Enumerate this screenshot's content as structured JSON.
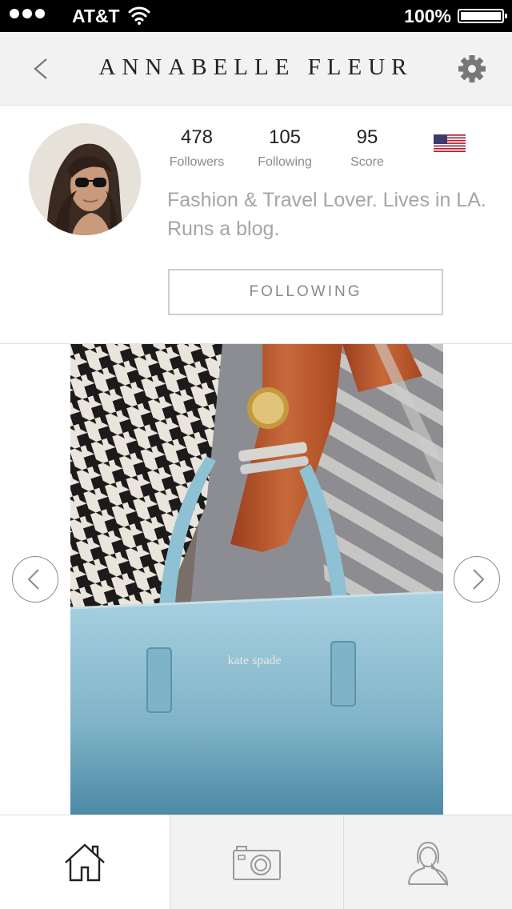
{
  "status_bar": {
    "carrier": "AT&T",
    "battery": "100%",
    "signal_icon": "signal-dots-icon",
    "wifi_icon": "wifi-icon",
    "battery_icon": "battery-icon"
  },
  "header": {
    "title": "ANNABELLE FLEUR",
    "back_icon": "chevron-left-icon",
    "settings_icon": "gear-icon"
  },
  "profile": {
    "stats": {
      "followers": {
        "value": "478",
        "label": "Followers"
      },
      "following": {
        "value": "105",
        "label": "Following"
      },
      "score": {
        "value": "95",
        "label": "Score"
      }
    },
    "flag_icon": "us-flag-icon",
    "bio": "Fashion & Travel Lover. Lives in LA. Runs a blog.",
    "follow_button": "FOLLOWING"
  },
  "photo": {
    "prev_icon": "chevron-left-circle-icon",
    "next_icon": "chevron-right-circle-icon"
  },
  "tabbar": {
    "items": [
      {
        "icon": "home-icon",
        "active": true
      },
      {
        "icon": "camera-icon",
        "active": false
      },
      {
        "icon": "user-icon",
        "active": false
      }
    ]
  },
  "colors": {
    "header_bg": "#f2f2f2",
    "text_dark": "#222222",
    "text_muted": "#8a8a8a",
    "bio_text": "#a5a5a5",
    "bag_blue": "#7fb3c7"
  }
}
